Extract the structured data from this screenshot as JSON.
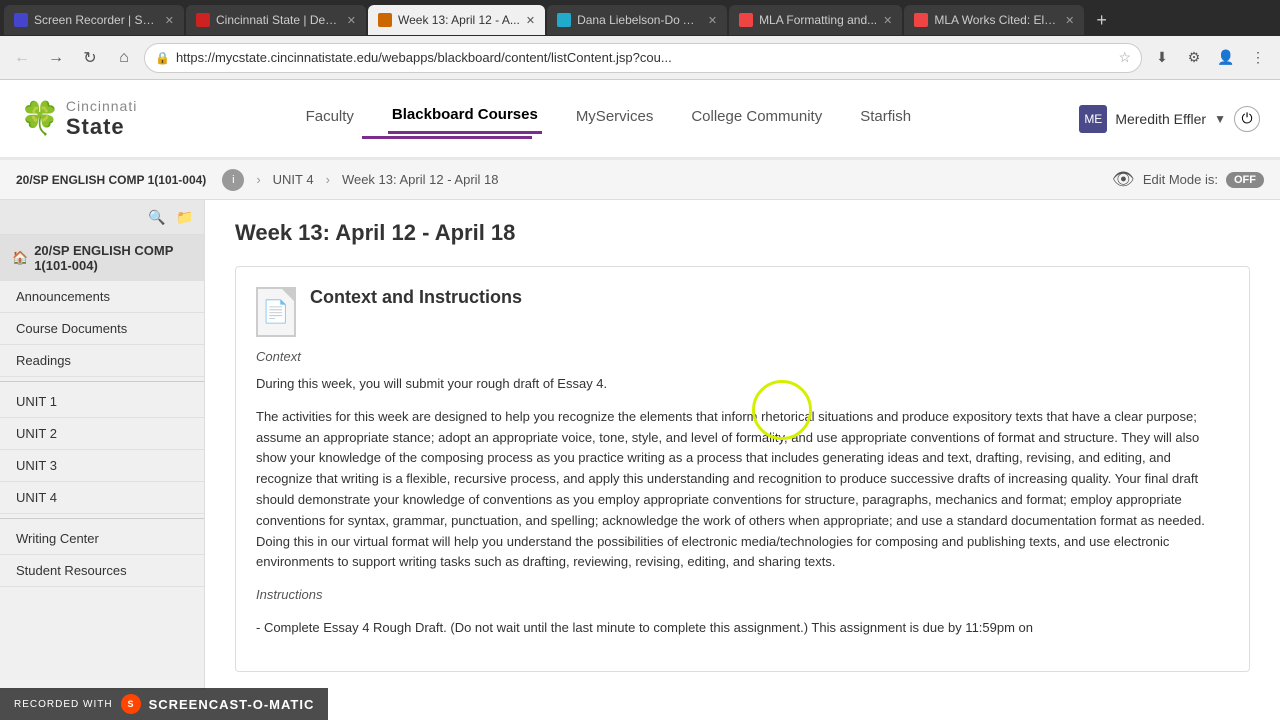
{
  "browser": {
    "tabs": [
      {
        "id": "tab1",
        "title": "Screen Recorder | Scr...",
        "favicon_class": "favicon-screen",
        "active": false
      },
      {
        "id": "tab2",
        "title": "Cincinnati State | Deg...",
        "favicon_class": "favicon-cincy",
        "active": false
      },
      {
        "id": "tab3",
        "title": "Week 13: April 12 - A...",
        "favicon_class": "favicon-bb",
        "active": true
      },
      {
        "id": "tab4",
        "title": "Dana Liebelson-Do Andr...",
        "favicon_class": "favicon-dana",
        "active": false
      },
      {
        "id": "tab5",
        "title": "MLA Formatting and...",
        "favicon_class": "favicon-mla1",
        "active": false
      },
      {
        "id": "tab6",
        "title": "MLA Works Cited: Ele...",
        "favicon_class": "favicon-mla2",
        "active": false
      }
    ],
    "url": "https://mycstate.cincinnatistate.edu/webapps/blackboard/content/listContent.jsp?cou..."
  },
  "site_header": {
    "logo_top": "Cincinnati",
    "logo_bottom": "State",
    "nav_links": [
      {
        "id": "faculty",
        "label": "Faculty",
        "active": false
      },
      {
        "id": "blackboard",
        "label": "Blackboard Courses",
        "active": true
      },
      {
        "id": "myservices",
        "label": "MyServices",
        "active": false
      },
      {
        "id": "college",
        "label": "College Community",
        "active": false
      },
      {
        "id": "starfish",
        "label": "Starfish",
        "active": false
      }
    ],
    "user_name": "Meredith Effler"
  },
  "breadcrumb": {
    "course": "20/SP ENGLISH COMP 1(101-004)",
    "unit": "UNIT 4",
    "page": "Week 13: April 12 - April 18",
    "edit_mode_label": "Edit Mode is:",
    "toggle_label": "OFF"
  },
  "sidebar": {
    "course_label": "20/SP ENGLISH COMP 1(101-004)",
    "items": [
      {
        "id": "announcements",
        "label": "Announcements"
      },
      {
        "id": "course-documents",
        "label": "Course Documents"
      },
      {
        "id": "readings",
        "label": "Readings"
      },
      {
        "id": "unit1",
        "label": "UNIT 1"
      },
      {
        "id": "unit2",
        "label": "UNIT 2"
      },
      {
        "id": "unit3",
        "label": "UNIT 3"
      },
      {
        "id": "unit4",
        "label": "UNIT 4"
      },
      {
        "id": "writing-center",
        "label": "Writing Center"
      },
      {
        "id": "student-resources",
        "label": "Student Resources"
      }
    ]
  },
  "content": {
    "page_title": "Week 13: April 12 - April 18",
    "card_title": "Context and Instructions",
    "subtitle": "Context",
    "para1": "During this week, you will submit your rough draft of Essay 4.",
    "para2": "The activities for this week are designed to help you recognize the elements that inform rhetorical situations and produce expository texts that have a clear purpose; assume an appropriate stance; adopt an appropriate voice, tone, style, and level of formality, and use appropriate conventions of format and structure. They will also show your knowledge of the composing process as you practice writing as a process that includes generating ideas and text, drafting, revising, and editing, and recognize that writing is a flexible, recursive process, and apply this understanding and recognition to produce successive drafts of increasing quality. Your final draft should demonstrate your knowledge of conventions as you employ appropriate conventions for structure, paragraphs, mechanics and format; employ appropriate conventions for syntax, grammar, punctuation, and spelling; acknowledge the work of others when appropriate; and use a standard documentation format as needed. Doing this in our virtual format will help you understand the possibilities of electronic media/technologies for composing and publishing texts, and use electronic environments to support writing tasks such as drafting, reviewing, revising, editing, and sharing texts.",
    "instructions_label": "Instructions",
    "instructions_text": "- Complete Essay 4 Rough Draft. (Do not wait until the last minute to complete this assignment.) This assignment is due by 11:59pm on"
  },
  "watermark": {
    "label": "RECORDED WITH",
    "brand": "SCREENCAST-O-MATIC"
  }
}
